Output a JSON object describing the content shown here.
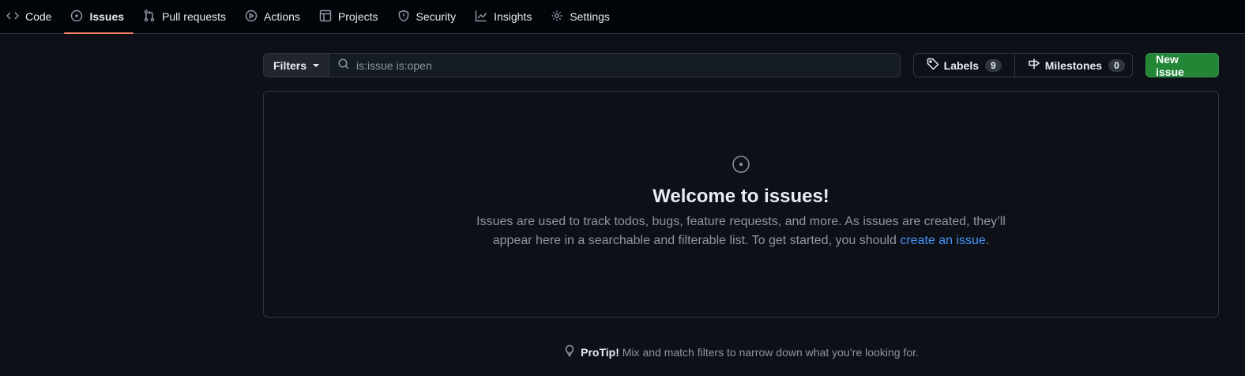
{
  "nav": {
    "tabs": [
      {
        "label": "Code",
        "icon": "code-icon"
      },
      {
        "label": "Issues",
        "icon": "issue-opened-icon",
        "active": true
      },
      {
        "label": "Pull requests",
        "icon": "git-pull-request-icon"
      },
      {
        "label": "Actions",
        "icon": "play-icon"
      },
      {
        "label": "Projects",
        "icon": "table-icon"
      },
      {
        "label": "Security",
        "icon": "shield-icon"
      },
      {
        "label": "Insights",
        "icon": "graph-icon"
      },
      {
        "label": "Settings",
        "icon": "gear-icon"
      }
    ]
  },
  "toolbar": {
    "filters_label": "Filters",
    "search_value": "is:issue is:open",
    "labels_label": "Labels",
    "labels_count": "9",
    "milestones_label": "Milestones",
    "milestones_count": "0",
    "new_issue_label": "New issue"
  },
  "blankslate": {
    "title": "Welcome to issues!",
    "desc_before": "Issues are used to track todos, bugs, feature requests, and more. As issues are created, they’ll appear here in a searchable and filterable list. To get started, you should ",
    "desc_link": "create an issue",
    "desc_after": "."
  },
  "protip": {
    "label": "ProTip!",
    "text": "Mix and match filters to narrow down what you’re looking for."
  },
  "colors": {
    "accent_underline": "#f78166",
    "primary_button": "#238636",
    "link": "#4493f8"
  }
}
